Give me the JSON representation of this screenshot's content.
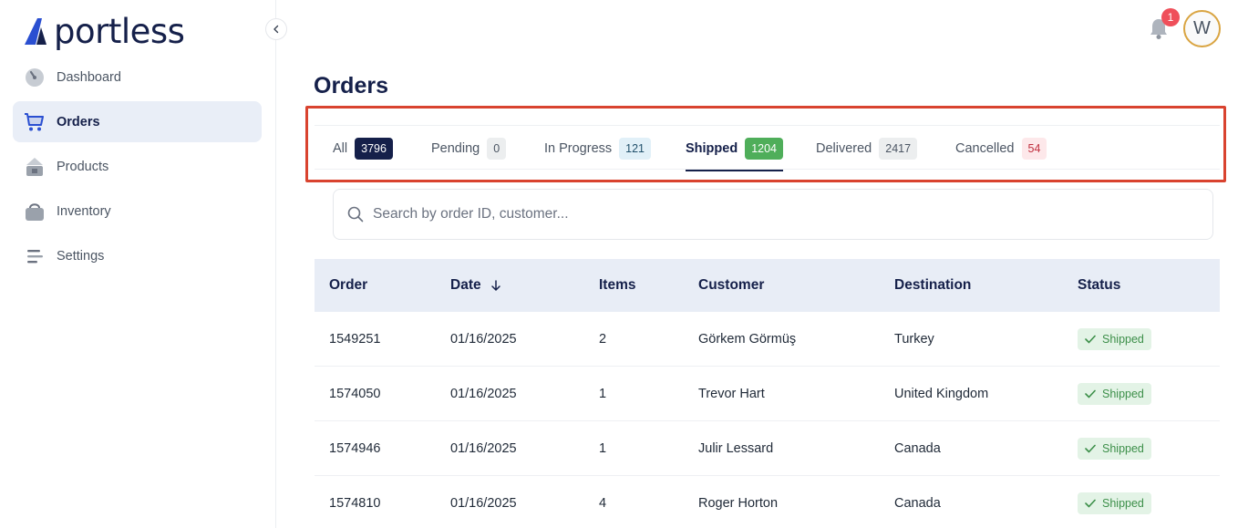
{
  "brand": {
    "name": "portless"
  },
  "sidebar": {
    "items": [
      {
        "label": "Dashboard",
        "icon": "dashboard-gauge-icon",
        "active": false
      },
      {
        "label": "Orders",
        "icon": "shopping-cart-icon",
        "active": true
      },
      {
        "label": "Products",
        "icon": "product-box-icon",
        "active": false
      },
      {
        "label": "Inventory",
        "icon": "inventory-bag-icon",
        "active": false
      },
      {
        "label": "Settings",
        "icon": "settings-sliders-icon",
        "active": false
      }
    ]
  },
  "header": {
    "notifications_count": "1",
    "avatar_initial": "W"
  },
  "page": {
    "title": "Orders"
  },
  "tabs": [
    {
      "label": "All",
      "count": "3796",
      "active": false
    },
    {
      "label": "Pending",
      "count": "0",
      "active": false
    },
    {
      "label": "In Progress",
      "count": "121",
      "active": false
    },
    {
      "label": "Shipped",
      "count": "1204",
      "active": true
    },
    {
      "label": "Delivered",
      "count": "2417",
      "active": false
    },
    {
      "label": "Cancelled",
      "count": "54",
      "active": false
    }
  ],
  "search": {
    "placeholder": "Search by order ID, customer..."
  },
  "table": {
    "columns": [
      "Order",
      "Date",
      "Items",
      "Customer",
      "Destination",
      "Status"
    ],
    "sort_indicator": "arrow-down-icon",
    "rows": [
      {
        "order": "1549251",
        "date": "01/16/2025",
        "items": "2",
        "customer": "Görkem Görmüş",
        "destination": "Turkey",
        "status": "Shipped"
      },
      {
        "order": "1574050",
        "date": "01/16/2025",
        "items": "1",
        "customer": "Trevor Hart",
        "destination": "United Kingdom",
        "status": "Shipped"
      },
      {
        "order": "1574946",
        "date": "01/16/2025",
        "items": "1",
        "customer": "Julir Lessard",
        "destination": "Canada",
        "status": "Shipped"
      },
      {
        "order": "1574810",
        "date": "01/16/2025",
        "items": "4",
        "customer": "Roger Horton",
        "destination": "Canada",
        "status": "Shipped"
      }
    ]
  },
  "colors": {
    "brand_navy": "#15204a",
    "logo_blue": "#2a4fd1",
    "active_nav_bg": "#e9eef7",
    "shipped_green": "#4fae5a",
    "highlight_red": "#d9432f",
    "notification_red": "#ef4f5a"
  }
}
